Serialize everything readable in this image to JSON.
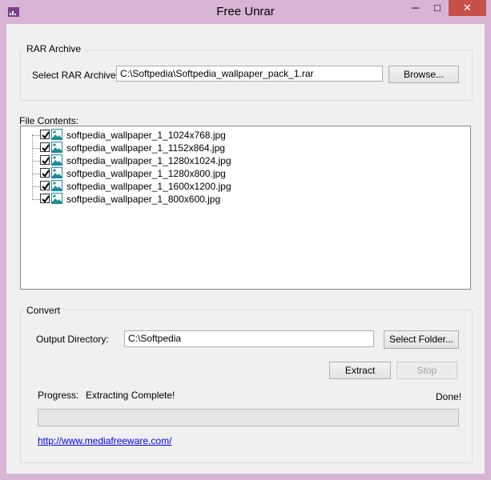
{
  "window": {
    "title": "Free Unrar",
    "controls": {
      "minimize": "─",
      "maximize": "□",
      "close": "✕"
    },
    "close_color": "#c7504a",
    "frame_color": "#d8b5d4"
  },
  "rar_group": {
    "label": "RAR Archive",
    "select_label": "Select RAR Archive:",
    "archive_path": "C:\\Softpedia\\Softpedia_wallpaper_pack_1.rar",
    "browse_label": "Browse..."
  },
  "file_contents": {
    "label": "File Contents:",
    "files": [
      "softpedia_wallpaper_1_1024x768.jpg",
      "softpedia_wallpaper_1_1152x864.jpg",
      "softpedia_wallpaper_1_1280x1024.jpg",
      "softpedia_wallpaper_1_1280x800.jpg",
      "softpedia_wallpaper_1_1600x1200.jpg",
      "softpedia_wallpaper_1_800x600.jpg"
    ]
  },
  "convert": {
    "label": "Convert",
    "output_label": "Output Directory:",
    "output_path": "C:\\Softpedia",
    "select_folder_label": "Select Folder...",
    "extract_label": "Extract",
    "stop_label": "Stop",
    "progress_label": "Progress:",
    "status_text": "Extracting Complete!",
    "done_text": "Done!",
    "progress_value": 0,
    "link_text": "http://www.mediafreeware.com/"
  }
}
